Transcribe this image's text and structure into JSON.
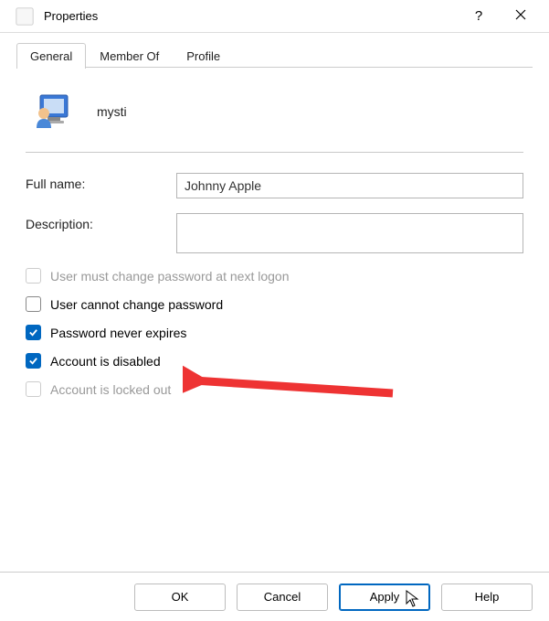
{
  "titlebar": {
    "title": "Properties"
  },
  "tabs": {
    "general": "General",
    "member_of": "Member Of",
    "profile": "Profile"
  },
  "user": {
    "name": "mysti"
  },
  "fields": {
    "full_name_label": "Full name:",
    "full_name_value": "Johnny Apple",
    "description_label": "Description:",
    "description_value": ""
  },
  "checks": {
    "must_change": "User must change password at next logon",
    "cannot_change": "User cannot change password",
    "never_expires": "Password never expires",
    "disabled": "Account is disabled",
    "locked": "Account is locked out"
  },
  "buttons": {
    "ok": "OK",
    "cancel": "Cancel",
    "apply": "Apply",
    "help": "Help"
  }
}
